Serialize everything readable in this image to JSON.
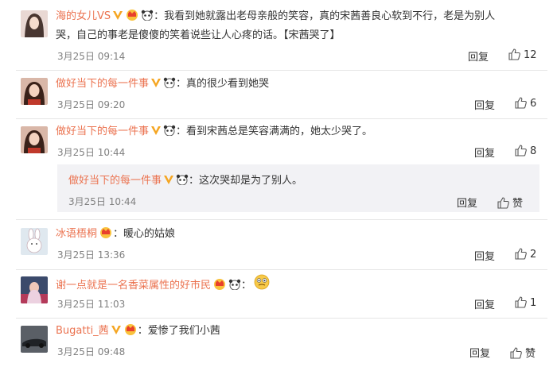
{
  "comments": [
    {
      "user": "海的女儿VS",
      "text_line1": "：我看到她就露出老母亲般的笑容，真的宋茜善良心软到不行，老是为别人",
      "text_line2": "哭，自己的事老是傻傻的笑着说些让人心疼的话。【宋茜哭了】",
      "time": "3月25日 09:14",
      "reply": "回复",
      "likes": "12"
    },
    {
      "user": "做好当下的每一件事",
      "text": "：真的很少看到她哭",
      "time": "3月25日 09:20",
      "reply": "回复",
      "likes": "6"
    },
    {
      "user": "做好当下的每一件事",
      "text": "：看到宋茜总是笑容满满的，她太少哭了。",
      "time": "3月25日 10:44",
      "reply": "回复",
      "likes": "8",
      "sub_reply": {
        "user": "做好当下的每一件事",
        "text": "：这次哭却是为了别人。",
        "time": "3月25日 10:44",
        "reply": "回复",
        "like_label": "赞"
      }
    },
    {
      "user": "冰语梧桐",
      "text": "：暖心的姑娘",
      "time": "3月25日 13:36",
      "reply": "回复",
      "likes": "2"
    },
    {
      "user": "谢一点就是一名香菜属性的好市民",
      "text": "：",
      "time": "3月25日 11:03",
      "reply": "回复",
      "likes": "1"
    },
    {
      "user": "Bugatti_茜",
      "text": "：爱惨了我们小茜",
      "time": "3月25日 09:48",
      "reply": "回复",
      "like_label": "赞"
    }
  ],
  "colors": {
    "username": "#eb7350",
    "text": "#333333",
    "meta": "#808080",
    "subbox": "#f2f2f5",
    "badge_orange": "#f5a623"
  },
  "icons": [
    "vip-v-icon",
    "crown-badge-icon",
    "panda-badge-icon",
    "like-thumb-icon",
    "emoji-face-icon"
  ]
}
